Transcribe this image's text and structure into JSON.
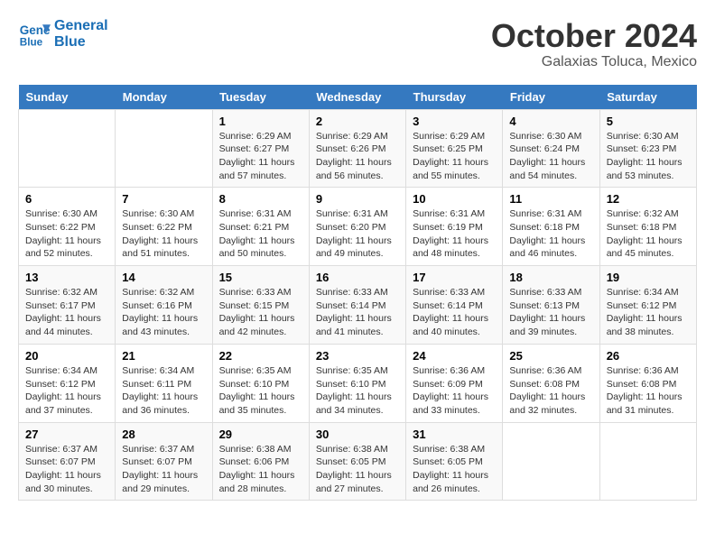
{
  "header": {
    "logo_line1": "General",
    "logo_line2": "Blue",
    "title": "October 2024",
    "subtitle": "Galaxias Toluca, Mexico"
  },
  "days_of_week": [
    "Sunday",
    "Monday",
    "Tuesday",
    "Wednesday",
    "Thursday",
    "Friday",
    "Saturday"
  ],
  "weeks": [
    [
      {
        "day": "",
        "info": ""
      },
      {
        "day": "",
        "info": ""
      },
      {
        "day": "1",
        "info": "Sunrise: 6:29 AM\nSunset: 6:27 PM\nDaylight: 11 hours and 57 minutes."
      },
      {
        "day": "2",
        "info": "Sunrise: 6:29 AM\nSunset: 6:26 PM\nDaylight: 11 hours and 56 minutes."
      },
      {
        "day": "3",
        "info": "Sunrise: 6:29 AM\nSunset: 6:25 PM\nDaylight: 11 hours and 55 minutes."
      },
      {
        "day": "4",
        "info": "Sunrise: 6:30 AM\nSunset: 6:24 PM\nDaylight: 11 hours and 54 minutes."
      },
      {
        "day": "5",
        "info": "Sunrise: 6:30 AM\nSunset: 6:23 PM\nDaylight: 11 hours and 53 minutes."
      }
    ],
    [
      {
        "day": "6",
        "info": "Sunrise: 6:30 AM\nSunset: 6:22 PM\nDaylight: 11 hours and 52 minutes."
      },
      {
        "day": "7",
        "info": "Sunrise: 6:30 AM\nSunset: 6:22 PM\nDaylight: 11 hours and 51 minutes."
      },
      {
        "day": "8",
        "info": "Sunrise: 6:31 AM\nSunset: 6:21 PM\nDaylight: 11 hours and 50 minutes."
      },
      {
        "day": "9",
        "info": "Sunrise: 6:31 AM\nSunset: 6:20 PM\nDaylight: 11 hours and 49 minutes."
      },
      {
        "day": "10",
        "info": "Sunrise: 6:31 AM\nSunset: 6:19 PM\nDaylight: 11 hours and 48 minutes."
      },
      {
        "day": "11",
        "info": "Sunrise: 6:31 AM\nSunset: 6:18 PM\nDaylight: 11 hours and 46 minutes."
      },
      {
        "day": "12",
        "info": "Sunrise: 6:32 AM\nSunset: 6:18 PM\nDaylight: 11 hours and 45 minutes."
      }
    ],
    [
      {
        "day": "13",
        "info": "Sunrise: 6:32 AM\nSunset: 6:17 PM\nDaylight: 11 hours and 44 minutes."
      },
      {
        "day": "14",
        "info": "Sunrise: 6:32 AM\nSunset: 6:16 PM\nDaylight: 11 hours and 43 minutes."
      },
      {
        "day": "15",
        "info": "Sunrise: 6:33 AM\nSunset: 6:15 PM\nDaylight: 11 hours and 42 minutes."
      },
      {
        "day": "16",
        "info": "Sunrise: 6:33 AM\nSunset: 6:14 PM\nDaylight: 11 hours and 41 minutes."
      },
      {
        "day": "17",
        "info": "Sunrise: 6:33 AM\nSunset: 6:14 PM\nDaylight: 11 hours and 40 minutes."
      },
      {
        "day": "18",
        "info": "Sunrise: 6:33 AM\nSunset: 6:13 PM\nDaylight: 11 hours and 39 minutes."
      },
      {
        "day": "19",
        "info": "Sunrise: 6:34 AM\nSunset: 6:12 PM\nDaylight: 11 hours and 38 minutes."
      }
    ],
    [
      {
        "day": "20",
        "info": "Sunrise: 6:34 AM\nSunset: 6:12 PM\nDaylight: 11 hours and 37 minutes."
      },
      {
        "day": "21",
        "info": "Sunrise: 6:34 AM\nSunset: 6:11 PM\nDaylight: 11 hours and 36 minutes."
      },
      {
        "day": "22",
        "info": "Sunrise: 6:35 AM\nSunset: 6:10 PM\nDaylight: 11 hours and 35 minutes."
      },
      {
        "day": "23",
        "info": "Sunrise: 6:35 AM\nSunset: 6:10 PM\nDaylight: 11 hours and 34 minutes."
      },
      {
        "day": "24",
        "info": "Sunrise: 6:36 AM\nSunset: 6:09 PM\nDaylight: 11 hours and 33 minutes."
      },
      {
        "day": "25",
        "info": "Sunrise: 6:36 AM\nSunset: 6:08 PM\nDaylight: 11 hours and 32 minutes."
      },
      {
        "day": "26",
        "info": "Sunrise: 6:36 AM\nSunset: 6:08 PM\nDaylight: 11 hours and 31 minutes."
      }
    ],
    [
      {
        "day": "27",
        "info": "Sunrise: 6:37 AM\nSunset: 6:07 PM\nDaylight: 11 hours and 30 minutes."
      },
      {
        "day": "28",
        "info": "Sunrise: 6:37 AM\nSunset: 6:07 PM\nDaylight: 11 hours and 29 minutes."
      },
      {
        "day": "29",
        "info": "Sunrise: 6:38 AM\nSunset: 6:06 PM\nDaylight: 11 hours and 28 minutes."
      },
      {
        "day": "30",
        "info": "Sunrise: 6:38 AM\nSunset: 6:05 PM\nDaylight: 11 hours and 27 minutes."
      },
      {
        "day": "31",
        "info": "Sunrise: 6:38 AM\nSunset: 6:05 PM\nDaylight: 11 hours and 26 minutes."
      },
      {
        "day": "",
        "info": ""
      },
      {
        "day": "",
        "info": ""
      }
    ]
  ]
}
